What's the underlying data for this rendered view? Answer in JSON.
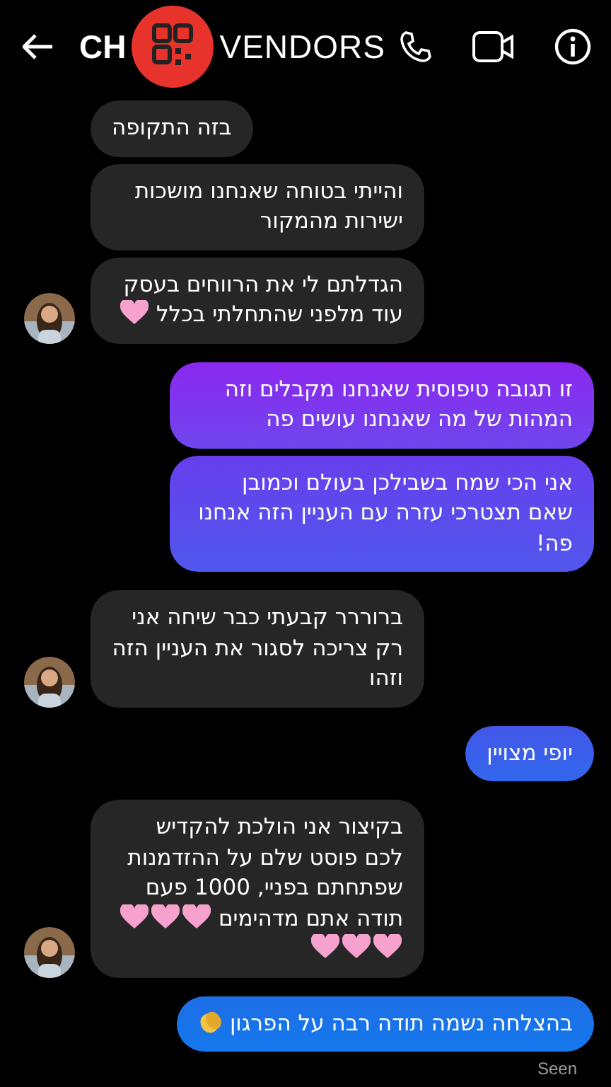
{
  "header": {
    "title_left": "CH",
    "title_right": "VENDORS"
  },
  "messages": [
    {
      "kind": "incoming",
      "text": "בזה התקופה",
      "avatar": false
    },
    {
      "kind": "incoming",
      "text": "והייתי בטוחה שאנחנו מושכות ישירות מהמקור",
      "avatar": false
    },
    {
      "kind": "incoming",
      "text": "הגדלתם לי את הרווחים בעסק עוד מלפני שהתחלתי בכלל",
      "emoji": [
        {
          "kind": "heart"
        }
      ],
      "avatar": true
    },
    {
      "kind": "outgoing",
      "text": "זו תגובה טיפוסית שאנחנו מקבלים וזה המהות של מה שאנחנו עושים פה"
    },
    {
      "kind": "outgoing",
      "text": "אני הכי שמח בשבילכן בעולם וכמובן שאם תצטרכי עזרה עם העניין הזה אנחנו פה!"
    },
    {
      "kind": "incoming",
      "text": "ברוררר קבעתי כבר שיחה אני רק צריכה לסגור את העניין הזה וזהו",
      "avatar": true
    },
    {
      "kind": "outgoing",
      "text": "יופי מצויין"
    },
    {
      "kind": "incoming",
      "text": "בקיצור אני הולכת להקדיש לכם פוסט שלם על ההזדמנות שפתחתם בפניי, 1000 פעם תודה אתם מדהימים",
      "emoji": [
        {
          "kind": "heart"
        },
        {
          "kind": "heart"
        },
        {
          "kind": "heart"
        },
        {
          "kind": "heart"
        },
        {
          "kind": "heart"
        },
        {
          "kind": "heart"
        }
      ],
      "avatar": true
    },
    {
      "kind": "outgoing",
      "text": "בהצלחה נשמה תודה רבה על הפרגון",
      "emoji": [
        {
          "kind": "clap"
        }
      ]
    }
  ],
  "status": "Seen"
}
